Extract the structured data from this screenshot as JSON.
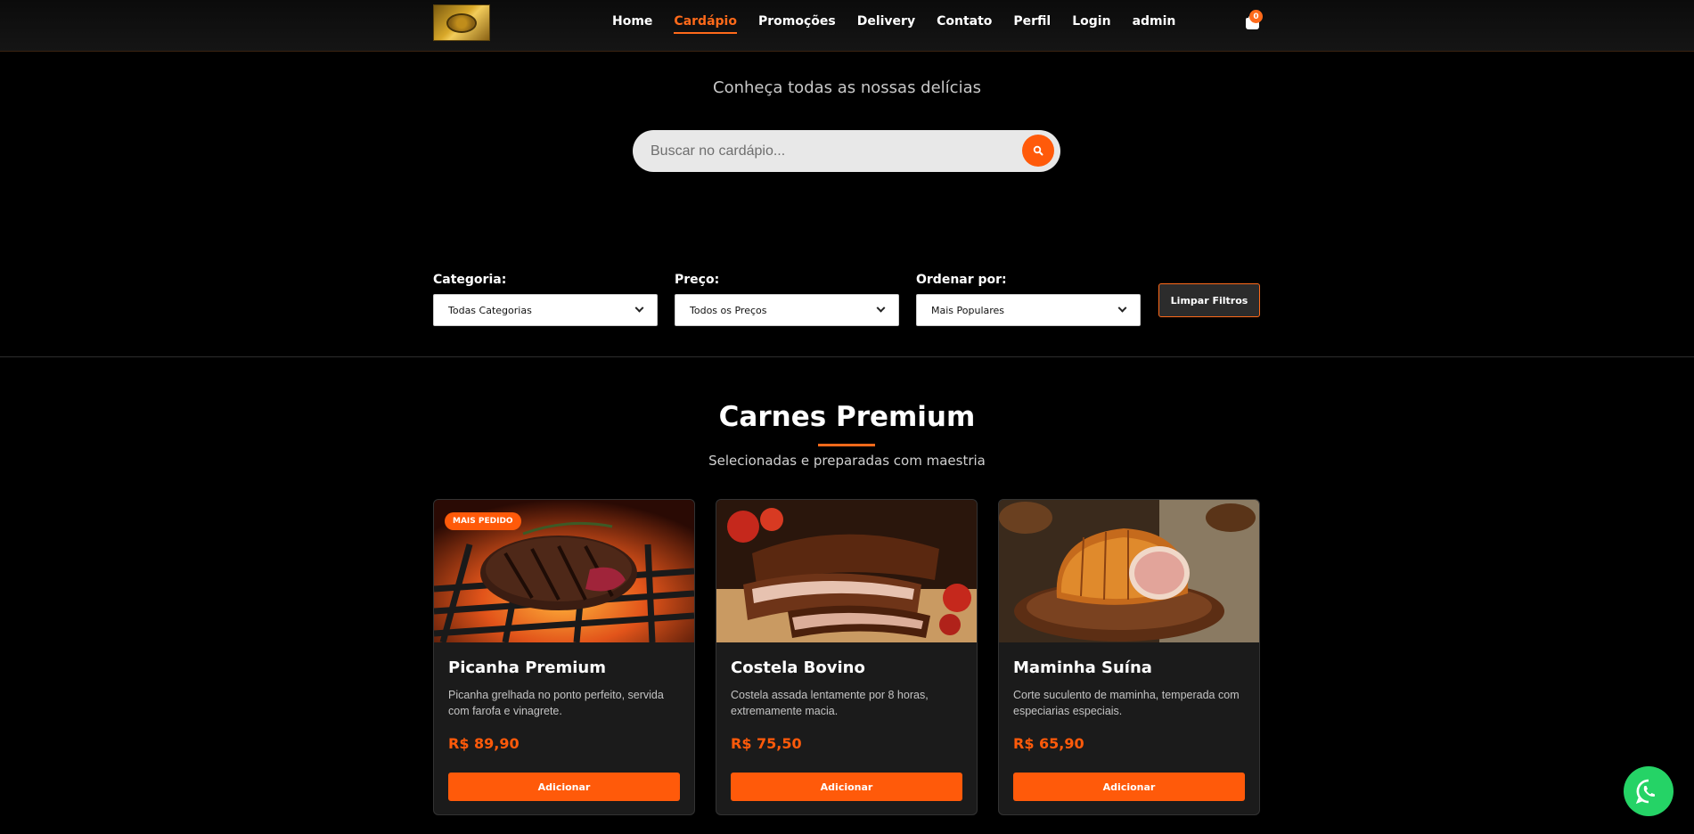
{
  "header": {
    "nav": [
      "Home",
      "Cardápio",
      "Promoções",
      "Delivery",
      "Contato",
      "Perfil",
      "Login",
      "admin"
    ],
    "active_index": 1,
    "cart_count": "0"
  },
  "hero": {
    "subtitle": "Conheça todas as nossas delícias",
    "search_placeholder": "Buscar no cardápio..."
  },
  "filters": {
    "category_label": "Categoria:",
    "category_value": "Todas Categorias",
    "price_label": "Preço:",
    "price_value": "Todos os Preços",
    "sort_label": "Ordenar por:",
    "sort_value": "Mais Populares",
    "clear_label": "Limpar Filtros"
  },
  "section": {
    "title": "Carnes Premium",
    "subtitle": "Selecionadas e preparadas com maestria"
  },
  "products": [
    {
      "badge": "MAIS PEDIDO",
      "name": "Picanha Premium",
      "description": "Picanha grelhada no ponto perfeito, servida com farofa e vinagrete.",
      "price": "R$ 89,90",
      "button": "Adicionar"
    },
    {
      "badge": "",
      "name": "Costela Bovino",
      "description": "Costela assada lentamente por 8 horas, extremamente macia.",
      "price": "R$ 75,50",
      "button": "Adicionar"
    },
    {
      "badge": "",
      "name": "Maminha Suína",
      "description": "Corte suculento de maminha, temperada com especiarias especiais.",
      "price": "R$ 65,90",
      "button": "Adicionar"
    }
  ],
  "colors": {
    "accent": "#ff5a0a",
    "background": "#000000",
    "card": "#1b1b1b",
    "whatsapp": "#25d366"
  },
  "icons": [
    "logo-icon",
    "cart-icon",
    "search-icon",
    "chevron-down-icon",
    "whatsapp-icon"
  ]
}
